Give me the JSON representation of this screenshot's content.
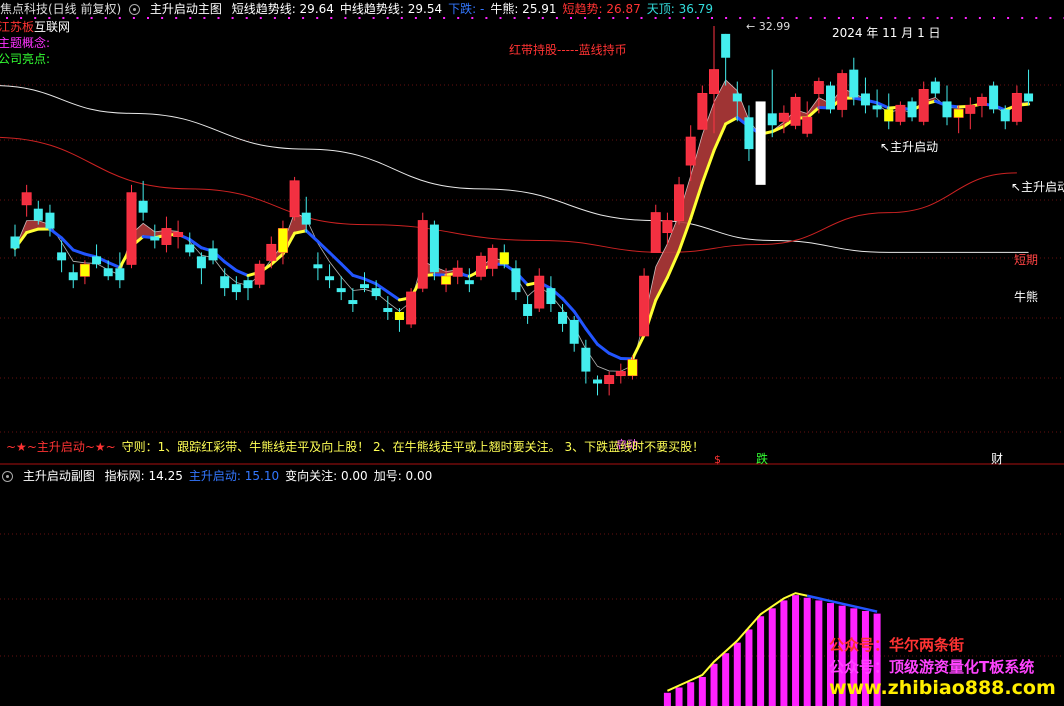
{
  "main_header": {
    "prefix": "焦点科技(日线 前复权)",
    "indicator_name": "主升启动主图",
    "items": [
      {
        "label": "短线趋势线:",
        "value": "29.64",
        "color": "#ffffff"
      },
      {
        "label": "中线趋势线:",
        "value": "29.54",
        "color": "#ffffff"
      },
      {
        "label": "下跌:",
        "value": "-",
        "color": "#3377ff"
      },
      {
        "label": "牛熊:",
        "value": "25.91",
        "color": "#ffffff"
      },
      {
        "label": "短趋势:",
        "value": "26.87",
        "color": "#ff3333"
      },
      {
        "label": "天顶:",
        "value": "36.79",
        "color": "#33dddd"
      }
    ]
  },
  "left_info": [
    {
      "label": "江苏板",
      "value": "互联网",
      "label_color": "#ff3333",
      "value_color": "#ffffff"
    },
    {
      "label": "主题概念:",
      "value": "",
      "label_color": "#ff33ff",
      "value_color": "#ffffff"
    },
    {
      "label": "公司亮点:",
      "value": "",
      "label_color": "#33ff33",
      "value_color": "#ffffff"
    }
  ],
  "annotations": {
    "hold_note": "红带持股-----蓝线持币",
    "date": "2024 年 11 月 1 日",
    "peak_price": "32.99",
    "signal1": "主升启动",
    "signal2": "主升启动",
    "line_short": "短期",
    "line_bull": "牛熊",
    "start_tag": "启动"
  },
  "rule_line": {
    "tag": "~★~主升启动~★~",
    "text": "守则：1、跟踪红彩带、牛熊线走平及向上股！ 2、在牛熊线走平或上翘时要关注。 3、下跌蓝线时不要买股！"
  },
  "markers": {
    "dollar": "$",
    "die": "跌",
    "cai": "财"
  },
  "sub_header": {
    "indicator_name": "主升启动副图",
    "items": [
      {
        "label": "指标网:",
        "value": "14.25",
        "color": "#ffffff"
      },
      {
        "label": "主升启动:",
        "value": "15.10",
        "color": "#3377ff"
      },
      {
        "label": "变向关注:",
        "value": "0.00",
        "color": "#ffffff"
      },
      {
        "label": "加号:",
        "value": "0.00",
        "color": "#ffffff"
      }
    ]
  },
  "watermarks": [
    "公众号：华尔两条街",
    "公众号：顶级游资量化T板系统",
    "www.zhibiao888.com"
  ],
  "colors": {
    "up": "#ff3344",
    "down": "#44eeee",
    "yellow_candle": "#ffff00",
    "ribbon": "#b03a3a",
    "trend_yellow": "#ffff33",
    "trend_blue": "#2255ff",
    "bull_line": "#e8e8e8",
    "short_line": "#cc2222",
    "magenta": "#ff22ff"
  },
  "chart_data": {
    "type": "candlestick",
    "price_range": [
      22.5,
      33.5
    ],
    "candles": [
      {
        "o": 28.0,
        "h": 28.3,
        "l": 27.5,
        "c": 27.7
      },
      {
        "o": 28.8,
        "h": 29.3,
        "l": 28.5,
        "c": 29.1
      },
      {
        "o": 28.7,
        "h": 28.9,
        "l": 28.3,
        "c": 28.4
      },
      {
        "o": 28.6,
        "h": 28.8,
        "l": 28.0,
        "c": 28.2
      },
      {
        "o": 27.6,
        "h": 27.9,
        "l": 27.1,
        "c": 27.4
      },
      {
        "o": 27.1,
        "h": 27.3,
        "l": 26.7,
        "c": 26.9
      },
      {
        "o": 27.0,
        "h": 27.4,
        "l": 26.8,
        "c": 27.3
      },
      {
        "o": 27.5,
        "h": 27.8,
        "l": 27.2,
        "c": 27.3
      },
      {
        "o": 27.2,
        "h": 27.4,
        "l": 26.9,
        "c": 27.0
      },
      {
        "o": 27.2,
        "h": 27.6,
        "l": 26.7,
        "c": 26.9
      },
      {
        "o": 27.3,
        "h": 29.3,
        "l": 27.2,
        "c": 29.1
      },
      {
        "o": 28.9,
        "h": 29.4,
        "l": 28.4,
        "c": 28.6
      },
      {
        "o": 28.0,
        "h": 28.3,
        "l": 27.7,
        "c": 27.9
      },
      {
        "o": 27.8,
        "h": 28.5,
        "l": 27.6,
        "c": 28.2
      },
      {
        "o": 28.0,
        "h": 28.4,
        "l": 27.7,
        "c": 28.1
      },
      {
        "o": 27.8,
        "h": 28.1,
        "l": 27.5,
        "c": 27.6
      },
      {
        "o": 27.5,
        "h": 27.6,
        "l": 26.8,
        "c": 27.2
      },
      {
        "o": 27.7,
        "h": 27.9,
        "l": 27.3,
        "c": 27.4
      },
      {
        "o": 27.0,
        "h": 27.2,
        "l": 26.5,
        "c": 26.7
      },
      {
        "o": 26.8,
        "h": 27.0,
        "l": 26.4,
        "c": 26.6
      },
      {
        "o": 26.9,
        "h": 27.0,
        "l": 26.4,
        "c": 26.7
      },
      {
        "o": 26.8,
        "h": 27.4,
        "l": 26.7,
        "c": 27.3
      },
      {
        "o": 27.4,
        "h": 28.0,
        "l": 27.2,
        "c": 27.8
      },
      {
        "o": 27.6,
        "h": 28.4,
        "l": 27.3,
        "c": 28.2
      },
      {
        "o": 28.5,
        "h": 29.5,
        "l": 28.4,
        "c": 29.4
      },
      {
        "o": 28.6,
        "h": 29.0,
        "l": 28.1,
        "c": 28.3
      },
      {
        "o": 27.3,
        "h": 27.6,
        "l": 26.9,
        "c": 27.2
      },
      {
        "o": 27.0,
        "h": 27.3,
        "l": 26.7,
        "c": 26.9
      },
      {
        "o": 26.7,
        "h": 27.0,
        "l": 26.4,
        "c": 26.6
      },
      {
        "o": 26.4,
        "h": 26.7,
        "l": 26.1,
        "c": 26.3
      },
      {
        "o": 26.8,
        "h": 27.1,
        "l": 26.6,
        "c": 26.7
      },
      {
        "o": 26.7,
        "h": 26.9,
        "l": 26.4,
        "c": 26.5
      },
      {
        "o": 26.2,
        "h": 26.5,
        "l": 25.9,
        "c": 26.1
      },
      {
        "o": 26.1,
        "h": 26.2,
        "l": 25.6,
        "c": 25.9
      },
      {
        "o": 25.8,
        "h": 26.7,
        "l": 25.7,
        "c": 26.6
      },
      {
        "o": 26.7,
        "h": 28.6,
        "l": 26.6,
        "c": 28.4
      },
      {
        "o": 28.3,
        "h": 28.4,
        "l": 26.9,
        "c": 27.1
      },
      {
        "o": 26.8,
        "h": 27.2,
        "l": 26.6,
        "c": 27.0
      },
      {
        "o": 27.0,
        "h": 27.4,
        "l": 26.8,
        "c": 27.2
      },
      {
        "o": 26.9,
        "h": 27.2,
        "l": 26.6,
        "c": 26.8
      },
      {
        "o": 27.0,
        "h": 27.6,
        "l": 26.9,
        "c": 27.5
      },
      {
        "o": 27.2,
        "h": 27.8,
        "l": 27.0,
        "c": 27.7
      },
      {
        "o": 27.6,
        "h": 27.8,
        "l": 27.2,
        "c": 27.3
      },
      {
        "o": 27.2,
        "h": 27.4,
        "l": 26.4,
        "c": 26.6
      },
      {
        "o": 26.3,
        "h": 26.5,
        "l": 25.8,
        "c": 26.0
      },
      {
        "o": 26.2,
        "h": 27.2,
        "l": 26.1,
        "c": 27.0
      },
      {
        "o": 26.7,
        "h": 27.0,
        "l": 26.1,
        "c": 26.3
      },
      {
        "o": 26.1,
        "h": 26.3,
        "l": 25.6,
        "c": 25.8
      },
      {
        "o": 25.9,
        "h": 26.0,
        "l": 25.1,
        "c": 25.3
      },
      {
        "o": 25.2,
        "h": 25.4,
        "l": 24.3,
        "c": 24.6
      },
      {
        "o": 24.4,
        "h": 24.5,
        "l": 24.0,
        "c": 24.3
      },
      {
        "o": 24.3,
        "h": 24.6,
        "l": 24.0,
        "c": 24.5
      },
      {
        "o": 24.5,
        "h": 24.8,
        "l": 24.3,
        "c": 24.6
      },
      {
        "o": 24.5,
        "h": 25.0,
        "l": 24.4,
        "c": 24.9
      },
      {
        "o": 25.5,
        "h": 27.2,
        "l": 25.5,
        "c": 27.0
      },
      {
        "o": 27.6,
        "h": 28.8,
        "l": 27.6,
        "c": 28.6
      },
      {
        "o": 28.1,
        "h": 28.6,
        "l": 27.8,
        "c": 28.4
      },
      {
        "o": 28.4,
        "h": 29.5,
        "l": 28.3,
        "c": 29.3
      },
      {
        "o": 29.8,
        "h": 30.8,
        "l": 29.4,
        "c": 30.5
      },
      {
        "o": 30.7,
        "h": 31.8,
        "l": 30.7,
        "c": 31.6
      },
      {
        "o": 31.6,
        "h": 33.3,
        "l": 30.6,
        "c": 32.2
      },
      {
        "o": 33.1,
        "h": 33.1,
        "l": 31.8,
        "c": 32.5
      },
      {
        "o": 31.6,
        "h": 31.9,
        "l": 30.9,
        "c": 31.4
      },
      {
        "o": 31.0,
        "h": 31.3,
        "l": 29.9,
        "c": 30.2
      },
      {
        "o": 30.9,
        "h": 31.2,
        "l": 29.8,
        "c": 30.1
      },
      {
        "o": 31.1,
        "h": 32.2,
        "l": 30.5,
        "c": 30.8
      },
      {
        "o": 30.9,
        "h": 31.3,
        "l": 30.6,
        "c": 31.1
      },
      {
        "o": 30.8,
        "h": 31.6,
        "l": 30.7,
        "c": 31.5
      },
      {
        "o": 30.6,
        "h": 31.4,
        "l": 30.5,
        "c": 31.0
      },
      {
        "o": 31.6,
        "h": 32.0,
        "l": 31.1,
        "c": 31.9
      },
      {
        "o": 31.8,
        "h": 31.9,
        "l": 31.1,
        "c": 31.2
      },
      {
        "o": 31.2,
        "h": 32.2,
        "l": 31.0,
        "c": 32.1
      },
      {
        "o": 32.2,
        "h": 32.5,
        "l": 31.3,
        "c": 31.5
      },
      {
        "o": 31.6,
        "h": 32.0,
        "l": 31.1,
        "c": 31.3
      },
      {
        "o": 31.3,
        "h": 31.7,
        "l": 31.0,
        "c": 31.2
      },
      {
        "o": 31.2,
        "h": 31.6,
        "l": 30.7,
        "c": 30.9
      },
      {
        "o": 30.9,
        "h": 31.4,
        "l": 30.8,
        "c": 31.3
      },
      {
        "o": 31.4,
        "h": 31.5,
        "l": 30.9,
        "c": 31.0
      },
      {
        "o": 30.9,
        "h": 31.9,
        "l": 30.8,
        "c": 31.7
      },
      {
        "o": 31.9,
        "h": 32.0,
        "l": 31.5,
        "c": 31.6
      },
      {
        "o": 31.4,
        "h": 31.8,
        "l": 30.8,
        "c": 31.0
      },
      {
        "o": 31.0,
        "h": 31.3,
        "l": 30.6,
        "c": 31.2
      },
      {
        "o": 31.1,
        "h": 31.5,
        "l": 30.7,
        "c": 31.3
      },
      {
        "o": 31.3,
        "h": 31.6,
        "l": 31.0,
        "c": 31.5
      },
      {
        "o": 31.8,
        "h": 31.9,
        "l": 31.1,
        "c": 31.2
      },
      {
        "o": 31.2,
        "h": 31.3,
        "l": 30.7,
        "c": 30.9
      },
      {
        "o": 30.9,
        "h": 31.8,
        "l": 30.8,
        "c": 31.6
      },
      {
        "o": 31.6,
        "h": 32.2,
        "l": 31.3,
        "c": 31.4
      }
    ],
    "sub_values": [
      0.5,
      0.7,
      0.9,
      1.1,
      1.6,
      2.0,
      2.4,
      2.9,
      3.4,
      3.7,
      4.0,
      4.2,
      4.1,
      4.0,
      3.9,
      3.8,
      3.7,
      3.6,
      3.5
    ],
    "sub_range": [
      0,
      6
    ]
  }
}
